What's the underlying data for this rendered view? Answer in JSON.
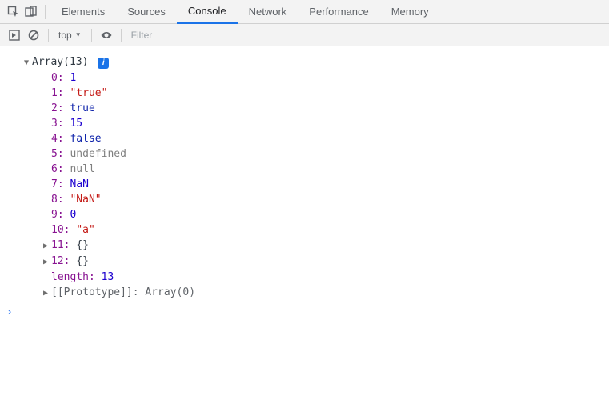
{
  "tabs": {
    "elements": "Elements",
    "sources": "Sources",
    "console": "Console",
    "network": "Network",
    "performance": "Performance",
    "memory": "Memory"
  },
  "toolbar": {
    "context": "top",
    "filter_placeholder": "Filter"
  },
  "array": {
    "header": "Array(13)",
    "info_badge": "i",
    "items": [
      {
        "key": "0",
        "display": "1",
        "type": "num"
      },
      {
        "key": "1",
        "display": "\"true\"",
        "type": "str"
      },
      {
        "key": "2",
        "display": "true",
        "type": "bool"
      },
      {
        "key": "3",
        "display": "15",
        "type": "num"
      },
      {
        "key": "4",
        "display": "false",
        "type": "bool"
      },
      {
        "key": "5",
        "display": "undefined",
        "type": "undef"
      },
      {
        "key": "6",
        "display": "null",
        "type": "undef"
      },
      {
        "key": "7",
        "display": "NaN",
        "type": "nan"
      },
      {
        "key": "8",
        "display": "\"NaN\"",
        "type": "str"
      },
      {
        "key": "9",
        "display": "0",
        "type": "num"
      },
      {
        "key": "10",
        "display": "\"a\"",
        "type": "str"
      }
    ],
    "obj11": {
      "key": "11",
      "display": "{}"
    },
    "obj12": {
      "key": "12",
      "display": "{}"
    },
    "length_key": "length",
    "length_val": "13",
    "proto_key": "[[Prototype]]",
    "proto_val": "Array(0)"
  }
}
